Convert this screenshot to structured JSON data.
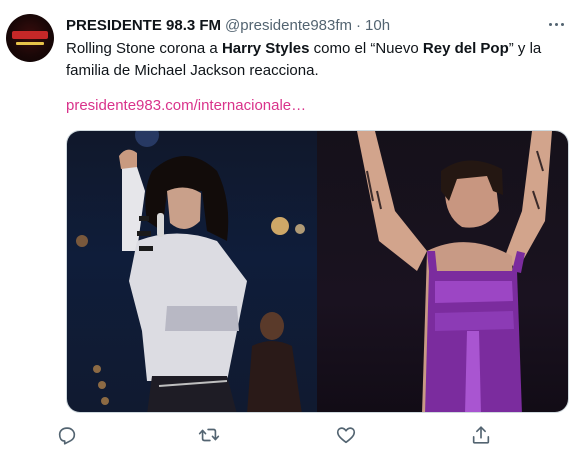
{
  "tweet": {
    "author_name": "PRESIDENTE 98.3 FM",
    "handle": "@presidente983fm",
    "separator": "·",
    "time": "10h",
    "text": {
      "part1": "Rolling Stone corona a ",
      "bold1": "Harry Styles",
      "part2": " como el “Nuevo ",
      "bold2": "Rey del Pop",
      "part3": "” y la familia de Michael Jackson reacciona."
    },
    "link": "presidente983.com/internacionale…"
  },
  "actions": {
    "icons": [
      "reply-icon",
      "retweet-icon",
      "like-icon",
      "share-icon"
    ]
  },
  "colors": {
    "link": "#d9338b",
    "secondary_text": "#536471",
    "icon": "#536471"
  }
}
